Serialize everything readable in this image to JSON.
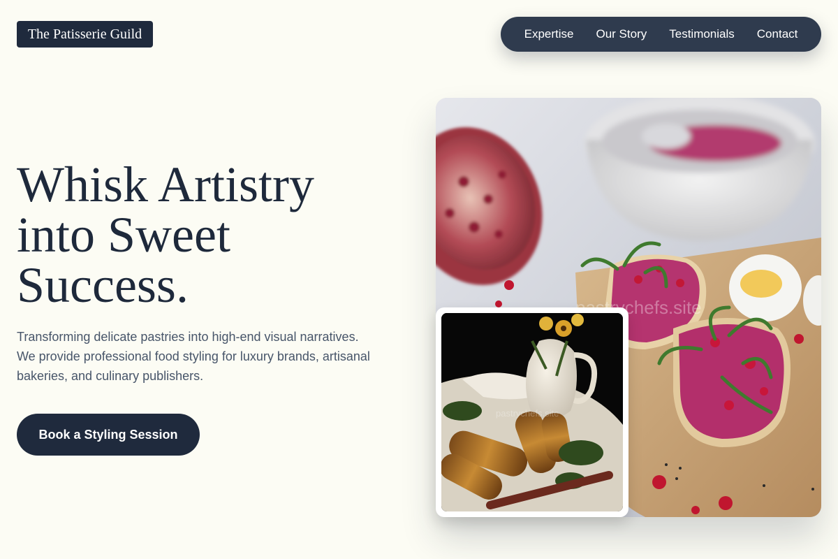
{
  "brand": {
    "name": "The Patisserie Guild"
  },
  "nav": {
    "items": [
      {
        "label": "Expertise"
      },
      {
        "label": "Our Story"
      },
      {
        "label": "Testimonials"
      },
      {
        "label": "Contact"
      }
    ]
  },
  "hero": {
    "title_lines": [
      "Whisk Artistry",
      "into Sweet",
      "Success."
    ],
    "description": "Transforming delicate pastries into high-end visual narratives. We provide professional food styling for luxury brands, artisanal bakeries, and culinary publishers.",
    "cta_label": "Book a Styling Session"
  },
  "images": {
    "main_watermark": "pastrychefs.site",
    "inset_watermark": "pastrychefs.site"
  },
  "colors": {
    "background": "#fcfcf4",
    "navy": "#1f2a3d",
    "nav_bg": "#2f3b4e",
    "text_muted": "#475569"
  }
}
